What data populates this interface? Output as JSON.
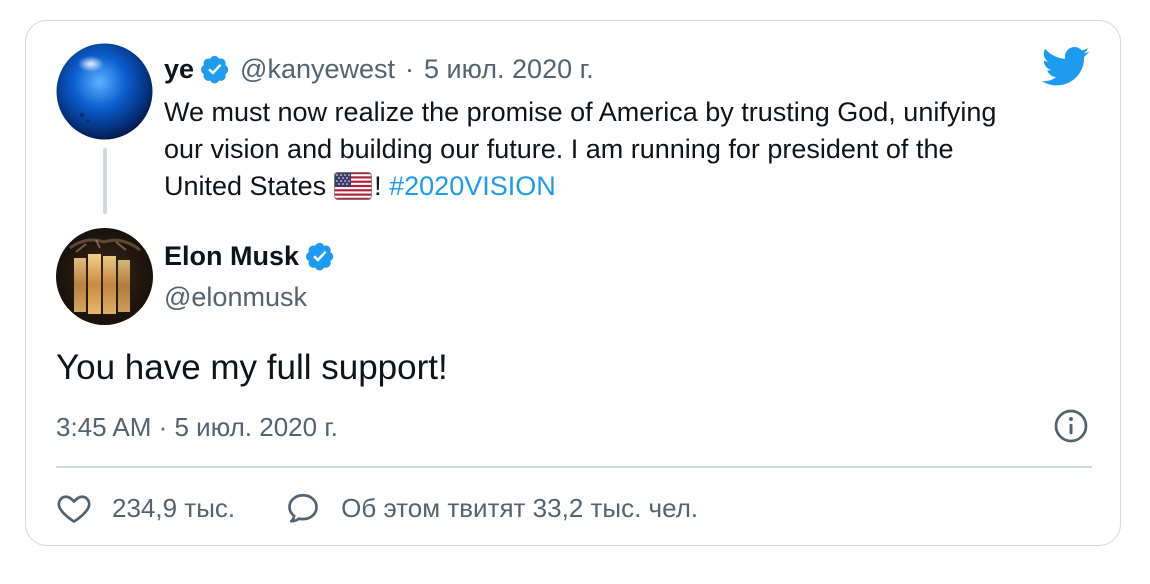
{
  "quoted_tweet": {
    "name": "ye",
    "handle": "@kanyewest",
    "separator": "·",
    "date": "5 июл. 2020 г.",
    "text_main": "We must now realize the promise of America by trusting God, unifying our vision and building our future. I am running for president of the United States",
    "text_after_flag": "!",
    "hashtag": "#2020VISION"
  },
  "author": {
    "name": "Elon Musk",
    "handle": "@elonmusk"
  },
  "tweet": {
    "text": "You have my full support!",
    "timestamp": "3:45 AM · 5 июл. 2020 г."
  },
  "actions": {
    "likes": "234,9 тыс.",
    "discussion": "Об этом твитят 33,2 тыс. чел."
  },
  "colors": {
    "link_blue": "#1d9bf0",
    "muted_gray": "#536471",
    "border": "#cfd9de"
  },
  "icons": [
    "twitter-bird-icon",
    "verified-badge-icon",
    "us-flag-icon",
    "info-icon",
    "heart-icon",
    "reply-bubble-icon"
  ]
}
